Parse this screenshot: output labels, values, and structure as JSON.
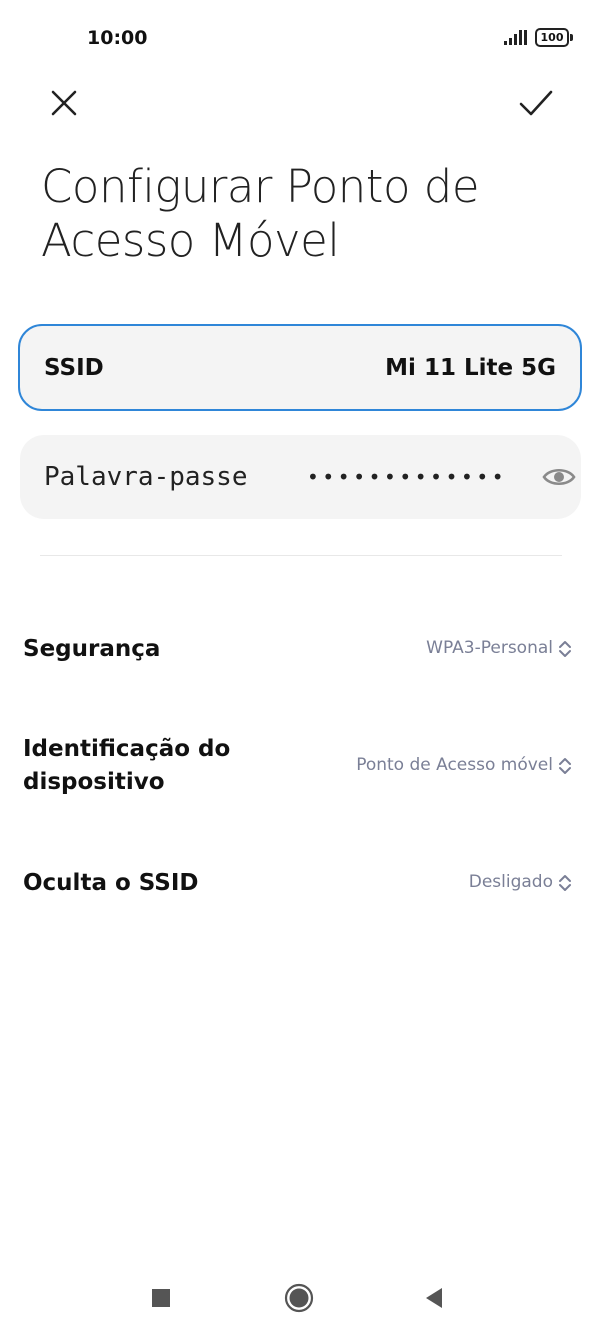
{
  "status_bar": {
    "time": "10:00",
    "battery": "100",
    "icons": [
      "signal-icon",
      "battery-icon"
    ]
  },
  "toolbar": {
    "close_icon": "close-icon",
    "confirm_icon": "check-icon"
  },
  "page": {
    "title": "Configurar Ponto de Acesso Móvel"
  },
  "ssid_field": {
    "label": "SSID",
    "value": "Mi 11 Lite 5G",
    "accent_color": "#2f86d8"
  },
  "password_field": {
    "label": "Palavra-passe",
    "masked_value": "•••••••••••••",
    "toggle_icon": "eye-icon"
  },
  "settings": [
    {
      "label": "Segurança",
      "value": "WPA3-Personal"
    },
    {
      "label": "Identificação do dispositivo",
      "value": "Ponto de Acesso móvel"
    },
    {
      "label": "Oculta o SSID",
      "value": "Desligado"
    }
  ],
  "nav_bar": {
    "icons": [
      "recents-square-icon",
      "home-circle-icon",
      "back-triangle-icon"
    ]
  }
}
